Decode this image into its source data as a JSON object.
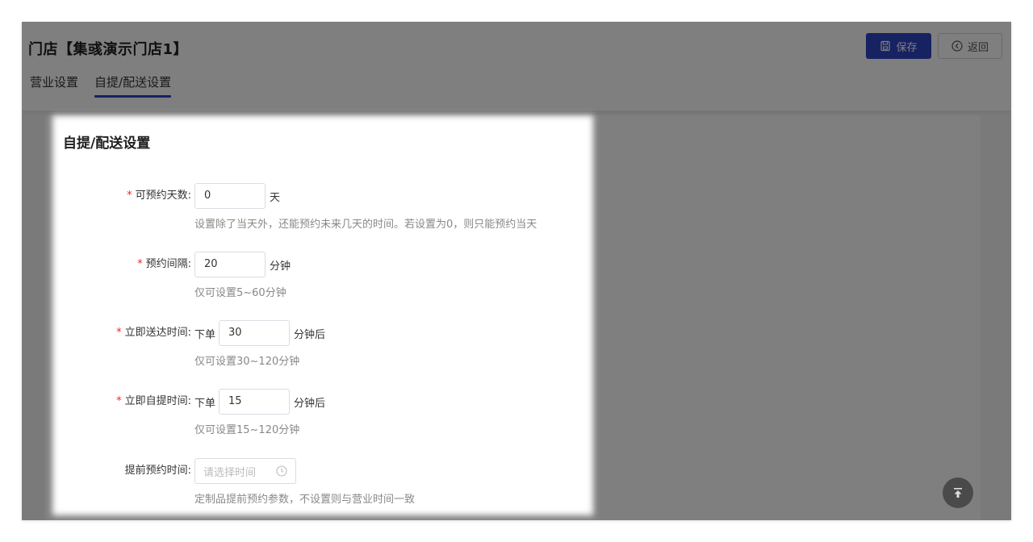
{
  "header": {
    "title": "门店【集彧演示门店1】",
    "tabs": [
      {
        "label": "营业设置",
        "active": false
      },
      {
        "label": "自提/配送设置",
        "active": true
      }
    ],
    "save_label": "保存",
    "back_label": "返回"
  },
  "card": {
    "title": "自提/配送设置",
    "fields": [
      {
        "required": "*",
        "label": "可预约天数:",
        "value": "0",
        "unit": "天",
        "hint": "设置除了当天外，还能预约未来几天的时间。若设置为0，则只能预约当天"
      },
      {
        "required": "*",
        "label": "预约间隔:",
        "value": "20",
        "unit": "分钟",
        "hint": "仅可设置5~60分钟"
      },
      {
        "required": "*",
        "label": "立即送达时间:",
        "prefix": "下单",
        "value": "30",
        "unit": "分钟后",
        "hint": "仅可设置30~120分钟"
      },
      {
        "required": "*",
        "label": "立即自提时间:",
        "prefix": "下单",
        "value": "15",
        "unit": "分钟后",
        "hint": "仅可设置15~120分钟"
      },
      {
        "label": "提前预约时间:",
        "placeholder": "请选择时间",
        "hint": "定制品提前预约参数，不设置则与营业时间一致"
      }
    ]
  },
  "colors": {
    "primary": "#2f45c5",
    "required": "#f5222d",
    "hint": "#888888",
    "overlay": "rgba(0,0,0,0.5)"
  },
  "icons": [
    "save-icon",
    "back-circle-icon",
    "clock-icon",
    "back-to-top-icon"
  ]
}
